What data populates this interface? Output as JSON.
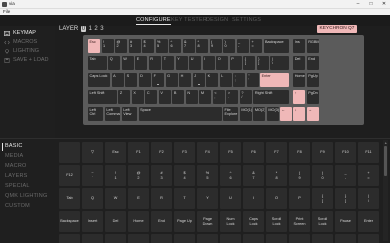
{
  "window": {
    "title": "via",
    "min": "–",
    "max": "□",
    "close": "✕"
  },
  "menu": {
    "file": "File"
  },
  "nav": {
    "configure": "CONFIGURE",
    "keytester": "KEY TESTER",
    "design": "DESIGN",
    "settings": "SETTINGS"
  },
  "sidebar": {
    "keymap": "KEYMAP",
    "macros": "MACROS",
    "lighting": "LIGHTING",
    "save_load": "SAVE + LOAD"
  },
  "layer": {
    "label": "LAYER",
    "numbers": [
      "0",
      "1",
      "2",
      "3"
    ],
    "active": "0"
  },
  "keyboard_name": "KEYCHRON Q7",
  "keys": [
    "Esc",
    "!\n1",
    "@\n2",
    "#\n3",
    "$\n4",
    "%\n5",
    "^\n6",
    "&\n7",
    "*\n8",
    "(\n9",
    ")\n0",
    "_\n-",
    "+\n=",
    "Backspace",
    "Ins",
    "RGBMH",
    "Tab",
    "Q",
    "W",
    "E",
    "R",
    "T",
    "Y",
    "U",
    "I",
    "O",
    "P",
    "{\n[",
    "}\n]",
    "|\n\\",
    "Del",
    "End",
    "Caps Lock",
    "A",
    "S",
    "D",
    "F",
    "G",
    "H",
    "J",
    "K",
    "L",
    ":\n;",
    "\"\n'",
    "Enter",
    "Home",
    "PgUp",
    "Left Shift",
    "Z",
    "X",
    "C",
    "V",
    "B",
    "N",
    "M",
    "<\n,",
    ">\n.",
    "?\n/",
    "Right Shift",
    "↑",
    "PgDn",
    "Left Ctrl",
    "Left\nCommand",
    "Left\nView",
    "Space",
    "File\nExplore",
    "MO(1)",
    "MO(2)",
    "MO(3)",
    "←",
    "↓",
    "→"
  ],
  "categories": {
    "basic": "BASIC",
    "media": "MEDIA",
    "macro": "MACRO",
    "layers": "LAYERS",
    "special": "SPECIAL",
    "qmk_lighting": "QMK LIGHTING",
    "custom": "CUSTOM"
  },
  "grid_keys": [
    "",
    "▽",
    "Esc",
    "F1",
    "F2",
    "F3",
    "F4",
    "F5",
    "F6",
    "F7",
    "F8",
    "F9",
    "F10",
    "F11",
    "F12",
    "~\n`",
    "!\n1",
    "@\n2",
    "#\n3",
    "$\n4",
    "%\n5",
    "^\n6",
    "&\n7",
    "*\n8",
    "(\n9",
    ")\n0",
    "_\n-",
    "+\n=",
    "Tab",
    "Q",
    "W",
    "E",
    "R",
    "T",
    "Y",
    "U",
    "I",
    "O",
    "P",
    "{\n[",
    "}\n]",
    "|\n\\",
    "Backspace",
    "Insert",
    "Del",
    "Home",
    "End",
    "Page Up",
    "Page\nDown",
    "Num\nLock",
    "Caps\nLock",
    "Scroll\nLock",
    "Print\nScreen",
    "Scroll\nLock",
    "Pause",
    "Enter",
    "",
    "",
    "",
    "",
    "",
    "",
    "",
    "",
    "",
    "",
    "",
    "",
    "",
    ""
  ],
  "colors": {
    "accent": "#f0b8b8",
    "key": "#2c2c2c",
    "plate": "#5b5b5b",
    "bg": "#1e1e1e"
  },
  "icons": {
    "keymap": "keyboard-icon",
    "macros": "code-icon",
    "lighting": "bulb-icon",
    "save": "save-icon"
  }
}
